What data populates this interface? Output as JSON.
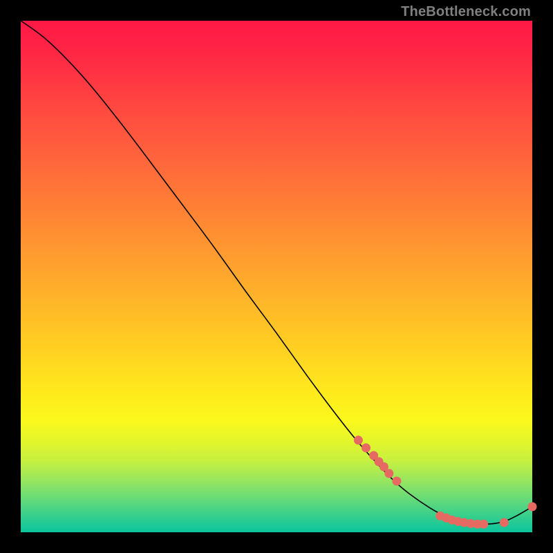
{
  "meta": {
    "watermark": "TheBottleneck.com"
  },
  "colors": {
    "background": "#000000",
    "curve_stroke": "#000000",
    "dot_fill": "#e66a62",
    "gradient_top": "#ff1846",
    "gradient_bottom": "#0cc59d"
  },
  "chart_data": {
    "type": "line",
    "title": "",
    "xlabel": "",
    "ylabel": "",
    "xlim": [
      0,
      100
    ],
    "ylim": [
      0,
      100
    ],
    "grid": false,
    "legend": false,
    "series": [
      {
        "name": "bottleneck-curve",
        "x": [
          0,
          3,
          6,
          10,
          14,
          20,
          26,
          32,
          38,
          44,
          50,
          56,
          62,
          66,
          70,
          74,
          78,
          82,
          86,
          90,
          94,
          97,
          100
        ],
        "y": [
          100,
          98,
          95.5,
          91.5,
          87,
          79.5,
          71.5,
          63.5,
          55.5,
          47,
          39,
          30.5,
          22.5,
          17.5,
          13,
          9,
          6,
          3.5,
          2,
          1.5,
          1.8,
          3.2,
          5
        ]
      }
    ],
    "scatter": [
      {
        "name": "markers",
        "points": [
          {
            "x": 66.0,
            "y": 18.0
          },
          {
            "x": 67.5,
            "y": 16.5
          },
          {
            "x": 69.0,
            "y": 15.0
          },
          {
            "x": 70.0,
            "y": 13.8
          },
          {
            "x": 71.0,
            "y": 12.8
          },
          {
            "x": 72.0,
            "y": 11.5
          },
          {
            "x": 73.5,
            "y": 10.0
          },
          {
            "x": 82.0,
            "y": 3.2
          },
          {
            "x": 83.2,
            "y": 2.8
          },
          {
            "x": 84.3,
            "y": 2.4
          },
          {
            "x": 85.5,
            "y": 2.1
          },
          {
            "x": 86.7,
            "y": 1.9
          },
          {
            "x": 88.0,
            "y": 1.7
          },
          {
            "x": 89.3,
            "y": 1.6
          },
          {
            "x": 90.5,
            "y": 1.6
          },
          {
            "x": 94.5,
            "y": 1.9
          },
          {
            "x": 100.0,
            "y": 5.0
          }
        ]
      }
    ]
  }
}
